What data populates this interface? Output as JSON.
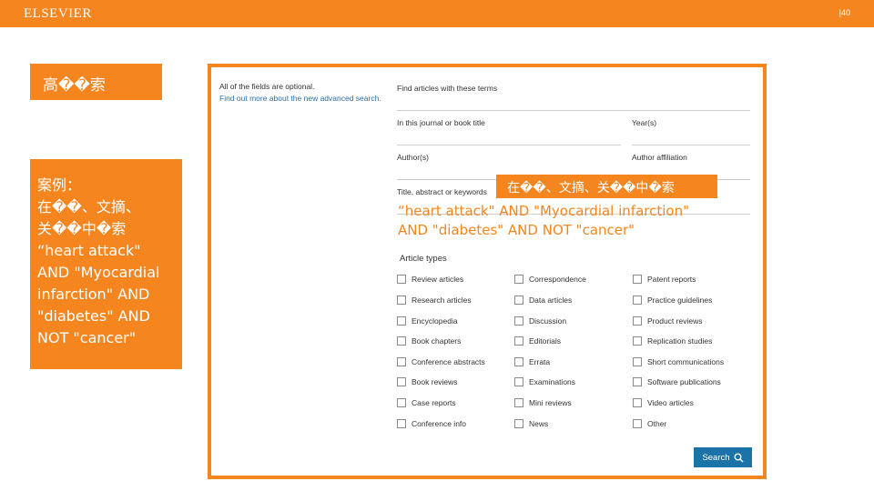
{
  "header": {
    "brand": "ELSEVIER",
    "page_number": "|40"
  },
  "left": {
    "advanced_search_label": "高��索",
    "case_lines": [
      "案例：",
      "在��、文摘、",
      "关��中�索",
      "“heart attack\"",
      "AND \"Myocardial",
      "infarction\" AND",
      "\"diabetes\" AND",
      "NOT \"cancer\""
    ]
  },
  "form": {
    "note_optional": "All of the fields are optional.",
    "note_link": "Find out more about the new advanced search.",
    "fields": {
      "terms": "Find articles with these terms",
      "journal": "In this journal or book title",
      "year": "Year(s)",
      "authors": "Author(s)",
      "affiliation": "Author affiliation",
      "title_abstract": "Title, abstract or keywords"
    },
    "article_types_title": "Article types",
    "article_types": {
      "col1": [
        "Review articles",
        "Research articles",
        "Encyclopedia",
        "Book chapters",
        "Conference abstracts",
        "Book reviews",
        "Case reports",
        "Conference info"
      ],
      "col2": [
        "Correspondence",
        "Data articles",
        "Discussion",
        "Editorials",
        "Errata",
        "Examinations",
        "Mini reviews",
        "News"
      ],
      "col3": [
        "Patent reports",
        "Practice guidelines",
        "Product reviews",
        "Replication studies",
        "Short communications",
        "Software publications",
        "Video articles",
        "Other"
      ]
    },
    "search_button": "Search"
  },
  "callout": {
    "tag": "在��、文摘、关��中�索",
    "lines": [
      "“heart attack\" AND \"Myocardial infarction\"",
      "AND \"diabetes\" AND NOT \"cancer\""
    ]
  },
  "colors": {
    "accent": "#f5861f",
    "button": "#1c73a8"
  }
}
